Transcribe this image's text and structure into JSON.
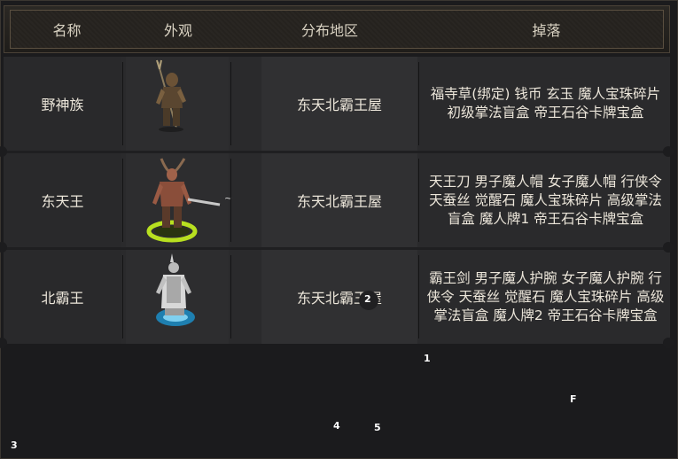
{
  "header": {
    "col_name": "名称",
    "col_look": "外观",
    "col_area": "分布地区",
    "col_drop": "掉落"
  },
  "rows": [
    {
      "name": "野神族",
      "figure_icon": "tribal-spearman-figure",
      "area": "东天北霸王屋",
      "drops": "福寺草(绑定) 钱币 玄玉 魔人宝珠碎片 初级掌法盲盒 帝王石谷卡牌宝盒"
    },
    {
      "name": "东天王",
      "figure_icon": "horned-warrior-figure",
      "area": "东天北霸王屋",
      "drops": "天王刀 男子魔人帽 女子魔人帽 行侠令 天蚕丝 觉醒石 魔人宝珠碎片 高级掌法盲盒 魔人牌1 帝王石谷卡牌宝盒"
    },
    {
      "name": "北霸王",
      "figure_icon": "armored-king-figure",
      "area": "东天北霸王屋",
      "drops": "霸王剑 男子魔人护腕 女子魔人护腕 行侠令 天蚕丝 觉醒石 魔人宝珠碎片 高级掌法盲盒 魔人牌2 帝王石谷卡牌宝盒"
    }
  ],
  "markers": {
    "m1": "1",
    "m2": "2",
    "m3": "3",
    "m4": "4",
    "m5": "5",
    "mF": "F",
    "tilde": "~"
  }
}
